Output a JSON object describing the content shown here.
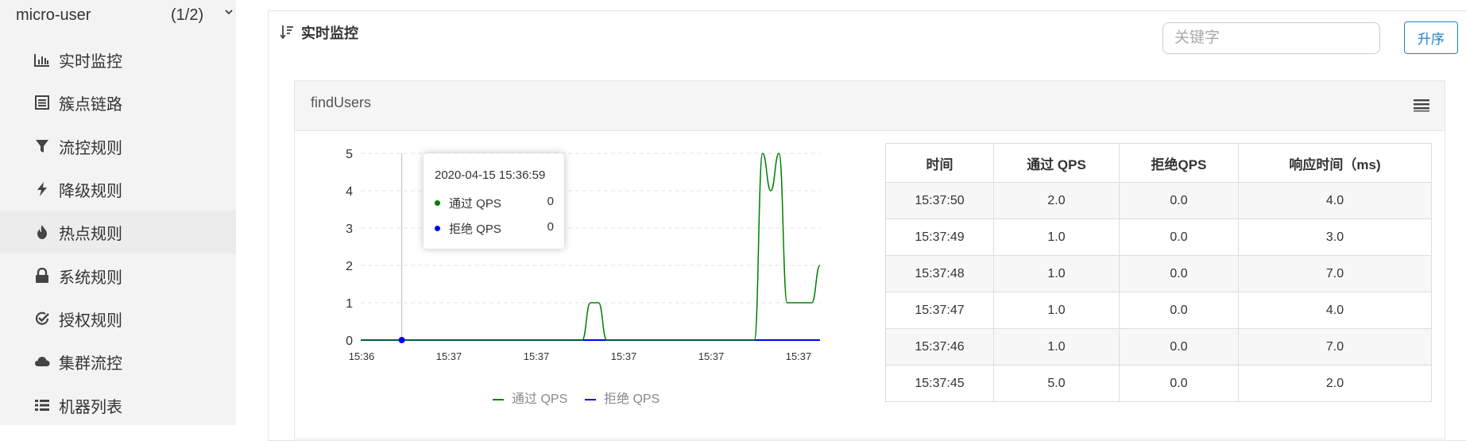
{
  "sidebar": {
    "app_name": "micro-user",
    "app_count": "(1/2)",
    "items": [
      {
        "label": "实时监控",
        "icon": "bar-chart-icon"
      },
      {
        "label": "簇点链路",
        "icon": "list-icon"
      },
      {
        "label": "流控规则",
        "icon": "filter-icon"
      },
      {
        "label": "降级规则",
        "icon": "flash-icon"
      },
      {
        "label": "热点规则",
        "icon": "fire-icon"
      },
      {
        "label": "系统规则",
        "icon": "lock-icon"
      },
      {
        "label": "授权规则",
        "icon": "check-circle-icon"
      },
      {
        "label": "集群流控",
        "icon": "cloud-icon"
      },
      {
        "label": "机器列表",
        "icon": "list-bullets-icon"
      }
    ]
  },
  "main": {
    "title": "实时监控",
    "search_placeholder": "关键字",
    "sort_label": "升序"
  },
  "card": {
    "title": "findUsers"
  },
  "tooltip": {
    "date": "2020-04-15 15:36:59",
    "rows": [
      {
        "name": "通过 QPS",
        "value": "0",
        "color": "#008000"
      },
      {
        "name": "拒绝 QPS",
        "value": "0",
        "color": "#0000ff"
      }
    ]
  },
  "chart_data": {
    "type": "line",
    "x_tick_labels": [
      "15:36",
      "15:37",
      "15:37",
      "15:37",
      "15:37",
      "15:37"
    ],
    "ylim": [
      0,
      5
    ],
    "y_ticks": [
      0,
      1,
      2,
      3,
      4,
      5
    ],
    "grid": true,
    "legend_position": "bottom",
    "series": [
      {
        "name": "通过 QPS",
        "color": "#008000",
        "values": [
          0,
          0,
          0,
          0,
          0,
          0,
          0,
          0,
          0,
          0,
          0,
          0,
          0,
          0,
          0,
          0,
          0,
          0,
          0,
          0,
          0,
          0,
          0,
          0,
          0,
          0,
          0,
          0,
          1,
          1,
          0,
          0,
          0,
          0,
          0,
          0,
          0,
          0,
          0,
          0,
          0,
          0,
          0,
          0,
          0,
          0,
          0,
          0,
          0,
          5,
          4,
          5,
          1,
          1,
          1,
          1,
          2
        ]
      },
      {
        "name": "拒绝 QPS",
        "color": "#0000ff",
        "values": [
          0,
          0,
          0,
          0,
          0,
          0,
          0,
          0,
          0,
          0,
          0,
          0,
          0,
          0,
          0,
          0,
          0,
          0,
          0,
          0,
          0,
          0,
          0,
          0,
          0,
          0,
          0,
          0,
          0,
          0,
          0,
          0,
          0,
          0,
          0,
          0,
          0,
          0,
          0,
          0,
          0,
          0,
          0,
          0,
          0,
          0,
          0,
          0,
          0,
          0,
          0,
          0,
          0,
          0,
          0,
          0,
          0
        ]
      }
    ]
  },
  "table": {
    "headers": [
      "时间",
      "通过 QPS",
      "拒绝QPS",
      "响应时间（ms)"
    ],
    "rows": [
      [
        "15:37:50",
        "2.0",
        "0.0",
        "4.0"
      ],
      [
        "15:37:49",
        "1.0",
        "0.0",
        "3.0"
      ],
      [
        "15:37:48",
        "1.0",
        "0.0",
        "7.0"
      ],
      [
        "15:37:47",
        "1.0",
        "0.0",
        "4.0"
      ],
      [
        "15:37:46",
        "1.0",
        "0.0",
        "7.0"
      ],
      [
        "15:37:45",
        "5.0",
        "0.0",
        "2.0"
      ]
    ]
  }
}
